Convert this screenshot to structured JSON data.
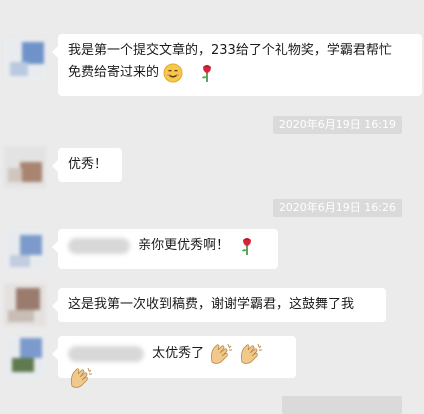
{
  "messages": [
    {
      "text_line1": "我是第一个提交文章的，233给了个礼物奖，学霸君帮忙",
      "text_line2": "免费给寄过来的"
    },
    {
      "timestamp": "2020年6月19日 16:19"
    },
    {
      "text": "优秀！"
    },
    {
      "timestamp": "2020年6月19日 16:26"
    },
    {
      "text": "亲你更优秀啊！"
    },
    {
      "text": "这是我第一次收到稿费，谢谢学霸君，这鼓舞了我"
    },
    {
      "text": "太优秀了"
    }
  ],
  "icons": {
    "smile": "smile-emoji-icon",
    "rose": "rose-icon",
    "clap": "clapping-hands-icon"
  },
  "colors": {
    "background": "#ebebeb",
    "bubble": "#ffffff",
    "timestamp_bg": "#dadada",
    "text": "#1a1a1a"
  }
}
